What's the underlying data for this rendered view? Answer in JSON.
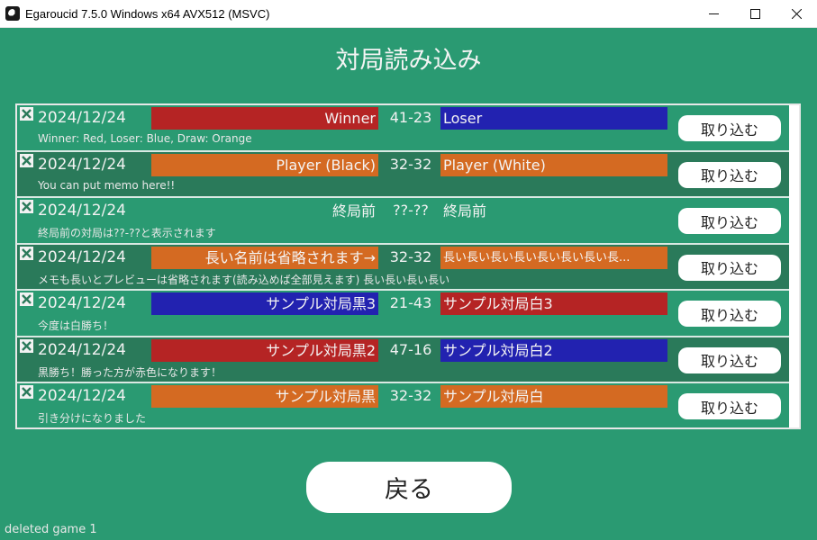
{
  "window": {
    "title": "Egaroucid 7.5.0 Windows x64 AVX512 (MSVC)"
  },
  "page": {
    "title": "対局読み込み"
  },
  "colors": {
    "red": "#b52424",
    "blue": "#2222b0",
    "orange": "#d46a22",
    "none": "transparent"
  },
  "games": [
    {
      "date": "2024/12/24",
      "black": "Winner",
      "black_color": "red",
      "score": "41-23",
      "white": "Loser",
      "white_color": "blue",
      "memo": "Winner: Red, Loser: Blue, Draw: Orange",
      "import_label": "取り込む"
    },
    {
      "date": "2024/12/24",
      "black": "Player (Black)",
      "black_color": "orange",
      "score": "32-32",
      "white": "Player (White)",
      "white_color": "orange",
      "memo": "You can put memo here!!",
      "import_label": "取り込む"
    },
    {
      "date": "2024/12/24",
      "black": "終局前",
      "black_color": "none",
      "score": "??-??",
      "white": "終局前",
      "white_color": "none",
      "memo": "終局前の対局は??-??と表示されます",
      "import_label": "取り込む"
    },
    {
      "date": "2024/12/24",
      "black": "長い名前は省略されます→",
      "black_color": "orange",
      "score": "32-32",
      "white": "長い長い長い長い長い長い長い長...",
      "white_color": "orange",
      "memo": "メモも長いとプレビューは省略されます(読み込めば全部見えます) 長い長い長い長い",
      "import_label": "取り込む"
    },
    {
      "date": "2024/12/24",
      "black": "サンプル対局黒3",
      "black_color": "blue",
      "score": "21-43",
      "white": "サンプル対局白3",
      "white_color": "red",
      "memo": "今度は白勝ち！",
      "import_label": "取り込む"
    },
    {
      "date": "2024/12/24",
      "black": "サンプル対局黒2",
      "black_color": "red",
      "score": "47-16",
      "white": "サンプル対局白2",
      "white_color": "blue",
      "memo": "黒勝ち！勝った方が赤色になります！",
      "import_label": "取り込む"
    },
    {
      "date": "2024/12/24",
      "black": "サンプル対局黒",
      "black_color": "orange",
      "score": "32-32",
      "white": "サンプル対局白",
      "white_color": "orange",
      "memo": "引き分けになりました",
      "import_label": "取り込む"
    }
  ],
  "back_label": "戻る",
  "status": "deleted game 1"
}
